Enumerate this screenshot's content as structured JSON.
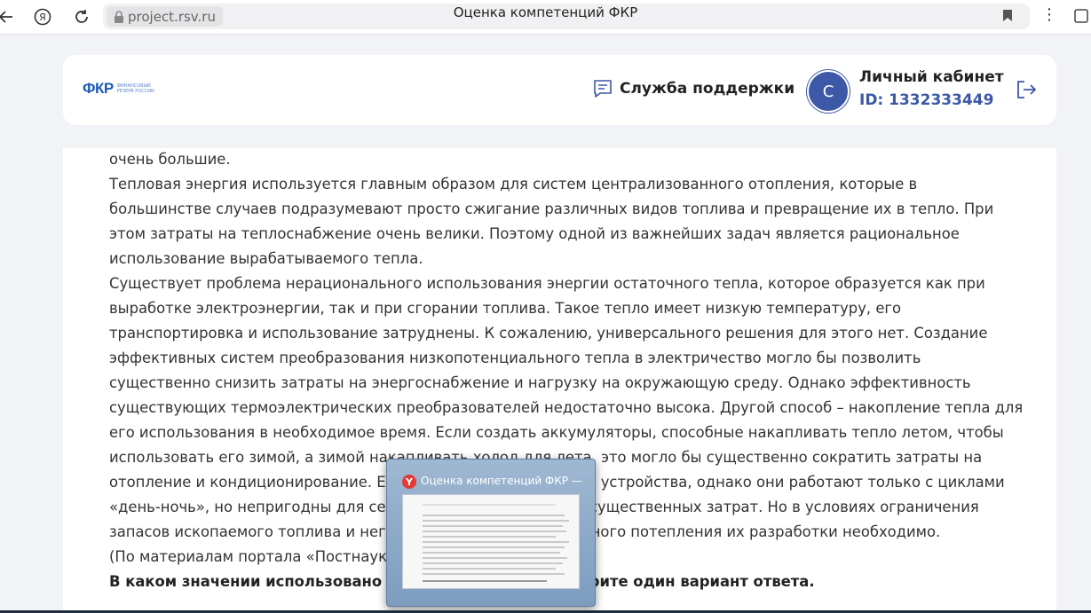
{
  "browser": {
    "url": "project.rsv.ru",
    "title": "Оценка компетенций ФКР",
    "ya_label": "Я"
  },
  "header": {
    "logo_mark": "ФКР",
    "logo_sub": "ФИНАНСОВЫЙ РЕЗЕРВ РОССИИ",
    "support_label": "Служба поддержки",
    "avatar_letter": "C",
    "cabinet_title": "Личный кабинет",
    "cabinet_id": "ID: 1332333449"
  },
  "content": {
    "paragraphs": [
      "очень большие.",
      "Тепловая энергия используется главным образом для систем централизованного отопления, которые в большинстве случаев подразумевают просто сжигание различных видов топлива и превращение их в тепло. При этом затраты на теплоснабжение очень велики. Поэтому одной из важнейших задач является рациональное использование вырабатываемого тепла.",
      "Существует проблема нерационального использования энергии остаточного тепла, которое образуется как при выработке электроэнергии, так и при сгорании топлива. Такое тепло имеет низкую температуру, его транспортировка и использование затруднены. К сожалению, универсального решения для этого нет. Создание эффективных систем преобразования низкопотенциального тепла в электричество могло бы позволить существенно снизить затраты на энергоснабжение и нагрузку на окружающую среду. Однако эффективность существующих термоэлектрических преобразователей недостаточно высока. Другой способ – накопление тепла для его использования в необходимое время. Если создать аккумуляторы, способные накапливать тепло летом, чтобы использовать его зимой, а зимой накапливать холод для лета, это могло бы существенно сократить затраты на отопление и кондиционирование. Есть попытки создать такие устройства, однако они работают только с циклами «день-ночь», но непригодны для сезонных циклов и требуют существенных затрат. Но в условиях ограничения запасов ископаемого топлива и негативного влияния глобального потепления их разработки необходимо.",
      "(По материалам портала «Постнаука»)"
    ],
    "question": "В каком значении использовано слово ... в тексте? Выберите один вариант ответа."
  },
  "thumbnail": {
    "title": "Оценка компетенций ФКР — Я...",
    "app_icon_letter": "Y"
  }
}
